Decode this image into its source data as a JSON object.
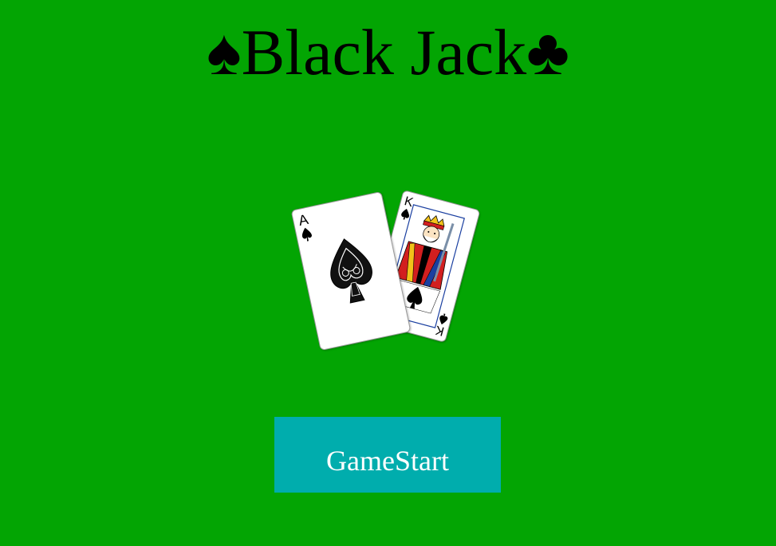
{
  "title": "♠Black Jack♣",
  "cards": {
    "ace": {
      "rank": "A",
      "suit": "spade"
    },
    "king": {
      "rank": "K",
      "suit": "spade"
    }
  },
  "start_button": {
    "label": "GameStart"
  },
  "colors": {
    "table_green": "#03a503",
    "button_teal": "#00adad",
    "button_text": "#ffffff",
    "title_text": "#000000"
  }
}
